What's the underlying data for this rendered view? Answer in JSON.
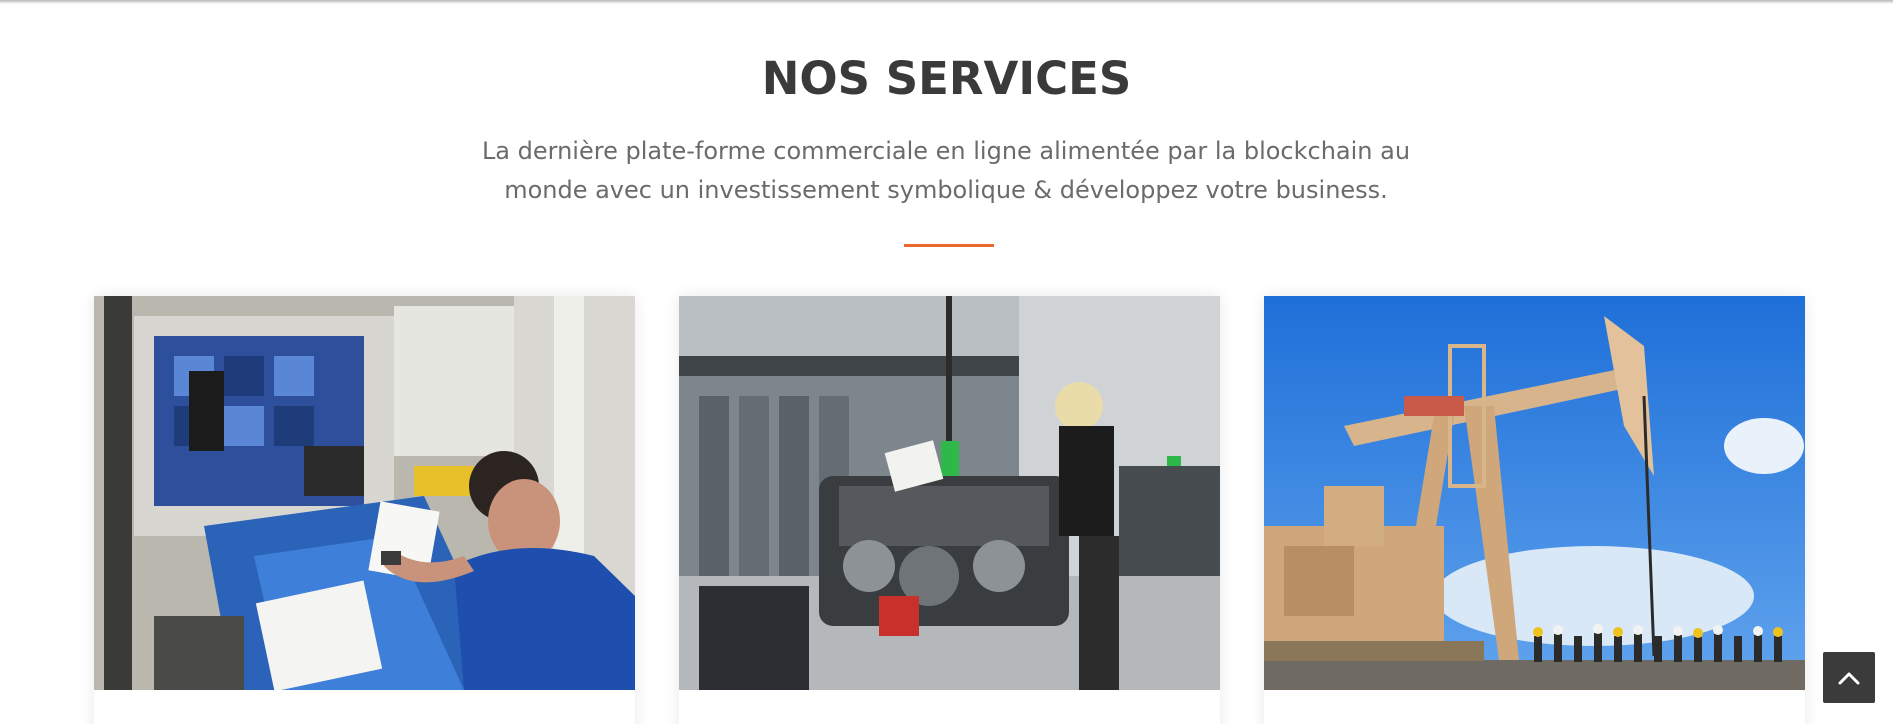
{
  "section": {
    "title": "NOS SERVICES",
    "subtitle": "La dernière plate-forme commerciale en ligne alimentée par la blockchain au monde avec un investissement symbolique & développez votre business."
  },
  "services": [
    {
      "image_alt": "Astronaut working in space station lab"
    },
    {
      "image_alt": "Engine assembly factory"
    },
    {
      "image_alt": "Oil pumpjack with visitors"
    }
  ],
  "colors": {
    "accent": "#e8692d",
    "title": "#3a3a3a",
    "text": "#6b6b6b",
    "scroll_button": "#3b3b3b"
  },
  "icons": {
    "scroll_top": "chevron-up-icon"
  }
}
